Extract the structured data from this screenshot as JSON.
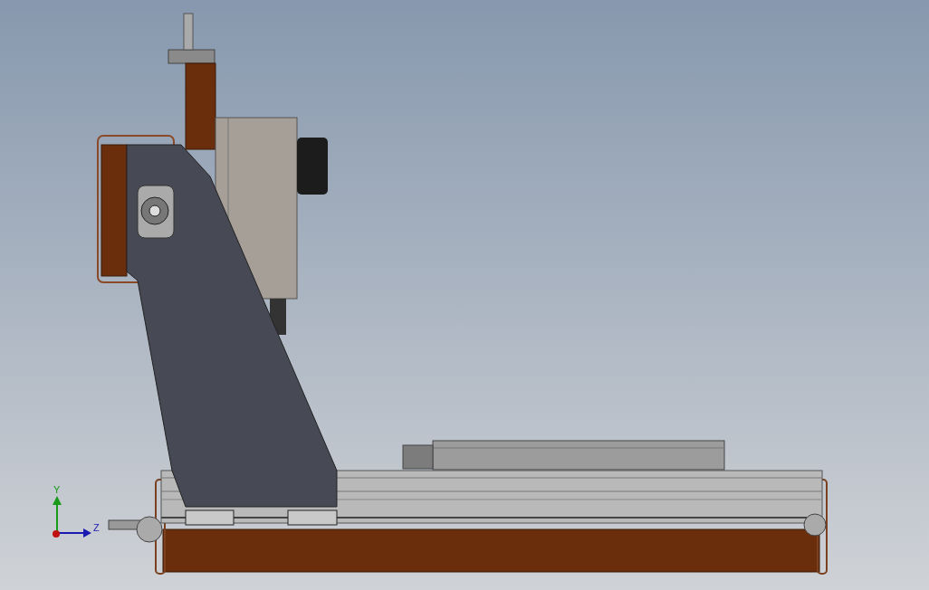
{
  "triad": {
    "axes": [
      {
        "label": "Y"
      },
      {
        "label": "Z"
      }
    ]
  }
}
